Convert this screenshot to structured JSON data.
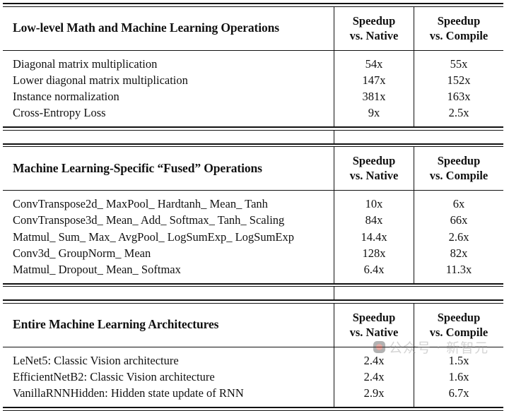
{
  "document": {
    "type": "benchmark-results-table",
    "background_color": "#ffffff",
    "text_color": "#111111",
    "rule_color": "#111111"
  },
  "columns": {
    "metric_a_line1": "Speedup",
    "metric_a_line2": "vs. Native",
    "metric_b_line1": "Speedup",
    "metric_b_line2": "vs. Compile"
  },
  "sections": [
    {
      "title": "Low-level Math and Machine Learning Operations",
      "rows": [
        {
          "name": "Diagonal matrix multiplication",
          "vs_native": "54x",
          "vs_compile": "55x"
        },
        {
          "name": "Lower diagonal matrix multiplication",
          "vs_native": "147x",
          "vs_compile": "152x"
        },
        {
          "name": "Instance normalization",
          "vs_native": "381x",
          "vs_compile": "163x"
        },
        {
          "name": "Cross-Entropy Loss",
          "vs_native": "9x",
          "vs_compile": "2.5x"
        }
      ]
    },
    {
      "title": "Machine Learning-Specific “Fused” Operations",
      "rows": [
        {
          "name": "ConvTranspose2d_ MaxPool_ Hardtanh_ Mean_ Tanh",
          "vs_native": "10x",
          "vs_compile": "6x"
        },
        {
          "name": "ConvTranspose3d_ Mean_ Add_ Softmax_ Tanh_ Scaling",
          "vs_native": "84x",
          "vs_compile": "66x"
        },
        {
          "name": "Matmul_ Sum_ Max_ AvgPool_ LogSumExp_ LogSumExp",
          "vs_native": "14.4x",
          "vs_compile": "2.6x"
        },
        {
          "name": "Conv3d_ GroupNorm_ Mean",
          "vs_native": "128x",
          "vs_compile": "82x"
        },
        {
          "name": "Matmul_ Dropout_ Mean_ Softmax",
          "vs_native": "6.4x",
          "vs_compile": "11.3x"
        }
      ]
    },
    {
      "title": "Entire Machine Learning Architectures",
      "rows": [
        {
          "name": "LeNet5: Classic Vision architecture",
          "vs_native": "2.4x",
          "vs_compile": "1.5x"
        },
        {
          "name": "EfficientNetB2: Classic Vision architecture",
          "vs_native": "2.4x",
          "vs_compile": "1.6x"
        },
        {
          "name": "VanillaRNNHidden: Hidden state update of RNN",
          "vs_native": "2.9x",
          "vs_compile": "6.7x"
        }
      ]
    }
  ],
  "watermark": {
    "text": "公众号 · 新智元",
    "logo_name": "wechat-account-logo",
    "color": "#9a9a9a"
  }
}
